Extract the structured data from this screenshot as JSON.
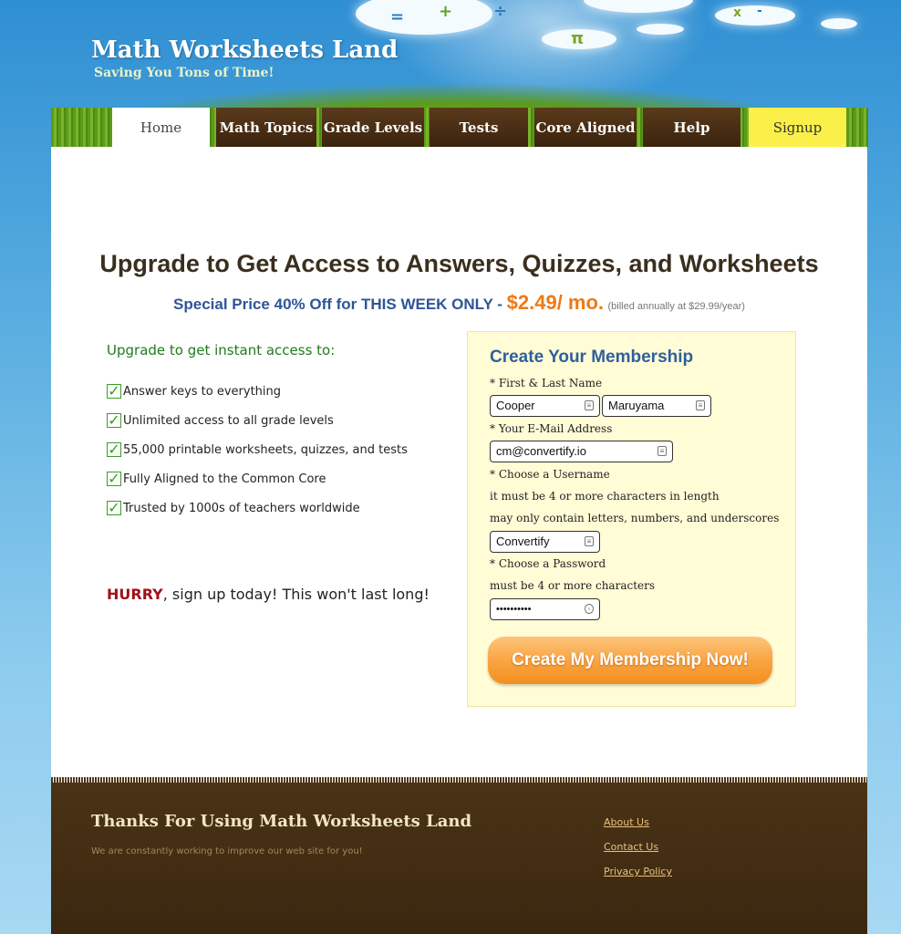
{
  "site": {
    "title": "Math Worksheets Land",
    "tagline": "Saving You Tons of Time!"
  },
  "header_symbols": {
    "equals": "=",
    "plus": "+",
    "divide": "÷",
    "pi": "π",
    "times": "x",
    "minus": "-"
  },
  "nav": {
    "items": [
      "Home",
      "Math Topics",
      "Grade Levels",
      "Tests",
      "Core Aligned",
      "Help",
      "Signup"
    ],
    "active": "Home"
  },
  "main": {
    "headline": "Upgrade to Get Access to Answers, Quizzes, and Worksheets",
    "price_text": "Special Price 40% Off for THIS WEEK ONLY - ",
    "price": "$2.49/ mo.",
    "price_note": "(billed annually at $29.99/year)"
  },
  "benefits": {
    "heading": "Upgrade to get instant access to:",
    "items": [
      "Answer keys to everything",
      "Unlimited access to all grade levels",
      "55,000 printable worksheets, quizzes, and tests",
      "Fully Aligned to the Common Core",
      "Trusted by 1000s of teachers worldwide"
    ],
    "check_glyph": "✓",
    "hurry_word": "HURRY",
    "hurry_rest": ", sign up today! This won't last long!"
  },
  "form": {
    "title": "Create Your Membership",
    "name_label": "* First & Last Name",
    "first_name": "Cooper",
    "last_name": "Maruyama",
    "email_label": "* Your E-Mail Address",
    "email": "cm@convertify.io",
    "username_label": "* Choose a Username",
    "username_hint1": "it must be 4 or more characters in length",
    "username_hint2": "may only contain letters, numbers, and underscores",
    "username": "Convertify",
    "password_label": "* Choose a Password",
    "password_hint": "must be 4 or more characters",
    "password_masked": "••••••••••",
    "submit": "Create My Membership Now!"
  },
  "footer": {
    "heading": "Thanks For Using Math Worksheets Land",
    "subtext": "We are constantly working to improve our web site for you!",
    "links": [
      "About Us",
      "Contact Us",
      "Privacy Policy"
    ]
  },
  "colors": {
    "sky": "#2f8fd3",
    "grass": "#5e9a1c",
    "nav_brown": "#3b230d",
    "signup_yellow": "#fbf04a",
    "form_bg": "#fffcd6",
    "form_title_blue": "#2f5f9e",
    "cta_orange": "#f9a23f",
    "hurry_red": "#a0111a",
    "footer_brown": "#4a3316",
    "footer_link": "#e8c27a"
  }
}
